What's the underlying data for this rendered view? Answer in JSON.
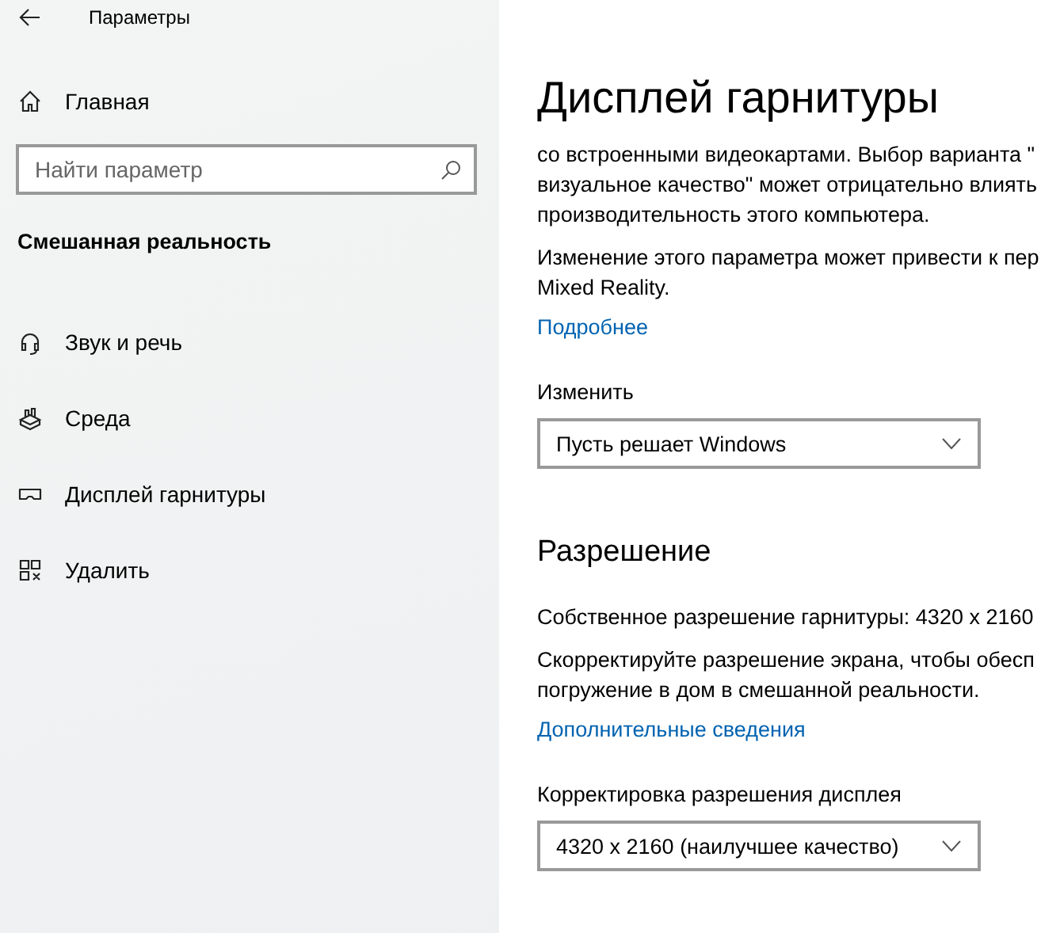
{
  "window": {
    "title": "Параметры"
  },
  "sidebar": {
    "home": "Главная",
    "search": {
      "placeholder": "Найти параметр"
    },
    "section": "Смешанная реальность",
    "items": [
      {
        "kind": "headset",
        "label": "Звук и речь"
      },
      {
        "kind": "environment",
        "label": "Среда"
      },
      {
        "kind": "display",
        "label": "Дисплей гарнитуры"
      },
      {
        "kind": "uninstall",
        "label": "Удалить"
      }
    ]
  },
  "content": {
    "title": "Дисплей гарнитуры",
    "blocks": [
      {
        "kind": "paragraph",
        "lines": [
          "со встроенными видеокартами. Выбор варианта \"",
          "визуальное качество\" может отрицательно влиять",
          "производительность этого компьютера."
        ]
      },
      {
        "kind": "paragraph",
        "lines": [
          "Изменение этого параметра может привести к пер",
          "Mixed Reality."
        ]
      },
      {
        "kind": "link",
        "text": "Подробнее"
      },
      {
        "kind": "dropdown",
        "label": "Изменить",
        "value": "Пусть решает Windows"
      },
      {
        "kind": "heading",
        "text": "Разрешение"
      },
      {
        "kind": "paragraph",
        "lines": [
          "Собственное разрешение гарнитуры: 4320 x 2160"
        ]
      },
      {
        "kind": "paragraph",
        "lines": [
          "Скорректируйте разрешение экрана, чтобы обесп",
          "погружение в дом в смешанной реальности."
        ]
      },
      {
        "kind": "link",
        "text": "Дополнительные сведения"
      },
      {
        "kind": "dropdown",
        "label": "Корректировка разрешения дисплея",
        "value": "4320 x 2160 (наилучшее качество)"
      }
    ]
  }
}
